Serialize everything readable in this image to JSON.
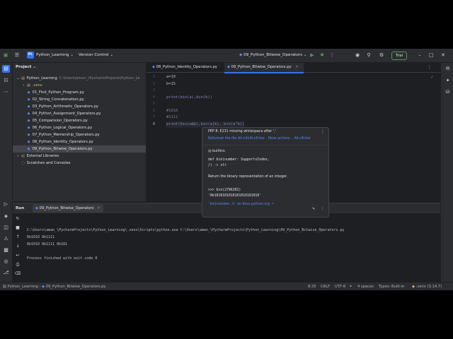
{
  "titlebar": {
    "project_badge": "PL",
    "project_name": "Python_Learning",
    "vcs": "Version Control",
    "run_config": "09_Python_Bitwise_Operators",
    "trial": "Trial"
  },
  "project_panel": {
    "title": "Project",
    "root_name": "Python_Learning",
    "root_path": "C:\\Users\\aman_\\PycharmProjects\\Python_Le",
    "venv": ".venv",
    "files": [
      "01_First_Python_Program.py",
      "02_String_Concatenation.py",
      "03_Python_Arithmetic_Operators.py",
      "04_Python_Assignment_Operators.py",
      "05_Comparision_Operators.py",
      "06_Python_Logical_Operators.py",
      "07_Python_Memership_Operators.py",
      "08_Python_Identity_Operators.py",
      "09_Python_Bitwise_Operators.py"
    ],
    "external_libraries": "External Libraries",
    "scratches": "Scratches and Consoles"
  },
  "editor": {
    "tabs": [
      "08_Python_Identity_Operators.py",
      "09_Python_Bitwise_Operators.py"
    ],
    "line_numbers": [
      "1",
      "2",
      "3",
      "4",
      "5",
      "6",
      "7",
      "8"
    ],
    "lines": [
      "a=10",
      "b=15",
      "",
      "print(bin(a),bin(b))",
      "",
      "#1010",
      "#1111",
      "print(bin(a&b),bin(a|b), bin(a^b))"
    ]
  },
  "popup": {
    "warning": "PEP 8: E231 missing whitespace after ','",
    "reformat": "Reformat the file",
    "reformat_shortcut": "Alt+Shift+Enter",
    "more_actions": "More actions...",
    "more_shortcut": "Alt+Enter",
    "module": "builtins",
    "signature_1": "def bin(number: SupportsIndex,",
    "signature_2": "        /) -> str",
    "description": "Return the binary representation of an integer.",
    "example_1": ">>> bin(2796202)",
    "example_2": "'0b1010101010101010101010'",
    "doc_link": "`bin(number, /)` on docs.python.org ↗"
  },
  "run": {
    "label": "Run",
    "tab": "09_Python_Bitwise_Operators",
    "console": [
      "C:\\Users\\aman_\\PycharmProjects\\Python_Learning\\.venv\\Scripts\\python.exe C:\\Users\\aman_\\PycharmProjects\\Python_Learning\\09_Python_Bitwise_Operators.py",
      "0b1010 0b1111",
      "0b1010 0b1111 0b101",
      "",
      "Process finished with exit code 0"
    ]
  },
  "status": {
    "breadcrumb_root": "Python_Learning",
    "breadcrumb_file": "09_Python_Bitwise_Operators.py",
    "position": "8:35",
    "line_ending": "CRLF",
    "encoding": "UTF-8",
    "indent": "4 spaces",
    "types": "Types: Built-in",
    "interpreter": ".venv (3.14.7)"
  }
}
